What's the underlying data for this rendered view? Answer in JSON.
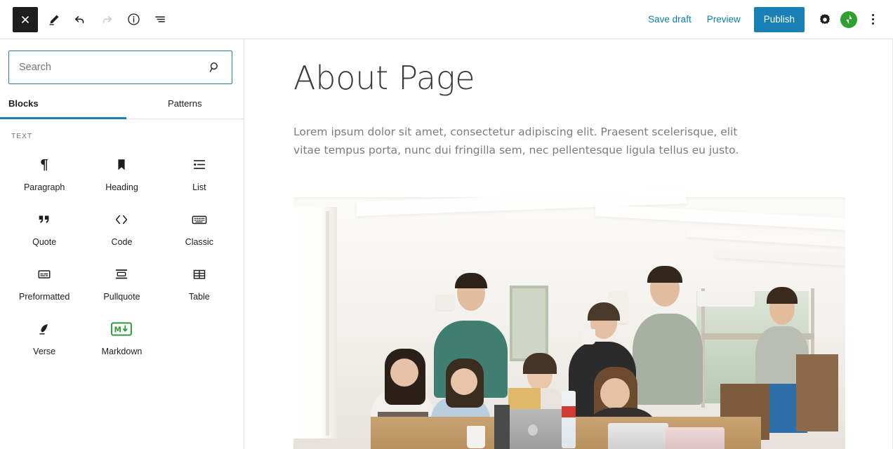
{
  "header": {
    "close_label": "×",
    "tools": [
      {
        "name": "close-editor-button",
        "icon": "close-icon",
        "title": "Close"
      },
      {
        "name": "edit-mode-button",
        "icon": "pencil-icon",
        "title": "Edit"
      },
      {
        "name": "undo-button",
        "icon": "undo-icon",
        "title": "Undo"
      },
      {
        "name": "redo-button",
        "icon": "redo-icon",
        "title": "Redo",
        "disabled": true
      },
      {
        "name": "details-button",
        "icon": "info-icon",
        "title": "Details"
      },
      {
        "name": "list-view-button",
        "icon": "list-view-icon",
        "title": "List view"
      }
    ],
    "save_draft_label": "Save draft",
    "preview_label": "Preview",
    "publish_label": "Publish",
    "settings_title": "Settings",
    "jetpack_title": "Jetpack",
    "more_title": "Options",
    "accent_color": "#1a7fb5",
    "link_color": "#0b7fab",
    "jetpack_color": "#2ea02e"
  },
  "inserter": {
    "search": {
      "placeholder": "Search",
      "value": "",
      "icon": "search-icon"
    },
    "tabs": [
      {
        "label": "Blocks",
        "active": true
      },
      {
        "label": "Patterns",
        "active": false
      }
    ],
    "category_label": "TEXT",
    "blocks": [
      {
        "label": "Paragraph",
        "icon": "paragraph-icon"
      },
      {
        "label": "Heading",
        "icon": "heading-icon"
      },
      {
        "label": "List",
        "icon": "list-icon"
      },
      {
        "label": "Quote",
        "icon": "quote-icon"
      },
      {
        "label": "Code",
        "icon": "code-icon"
      },
      {
        "label": "Classic",
        "icon": "classic-icon"
      },
      {
        "label": "Preformatted",
        "icon": "preformatted-icon"
      },
      {
        "label": "Pullquote",
        "icon": "pullquote-icon"
      },
      {
        "label": "Table",
        "icon": "table-icon"
      },
      {
        "label": "Verse",
        "icon": "verse-icon"
      },
      {
        "label": "Markdown",
        "icon": "markdown-icon"
      }
    ]
  },
  "editor": {
    "title": "About Page",
    "paragraph": "Lorem ipsum dolor sit amet, consectetur adipiscing elit. Praesent scelerisque, elit vitae tempus porta, nunc dui fringilla sem, nec pellentesque ligula tellus eu justo.",
    "image_alt": "Group of young people gathered around laptops in a bright white room"
  }
}
